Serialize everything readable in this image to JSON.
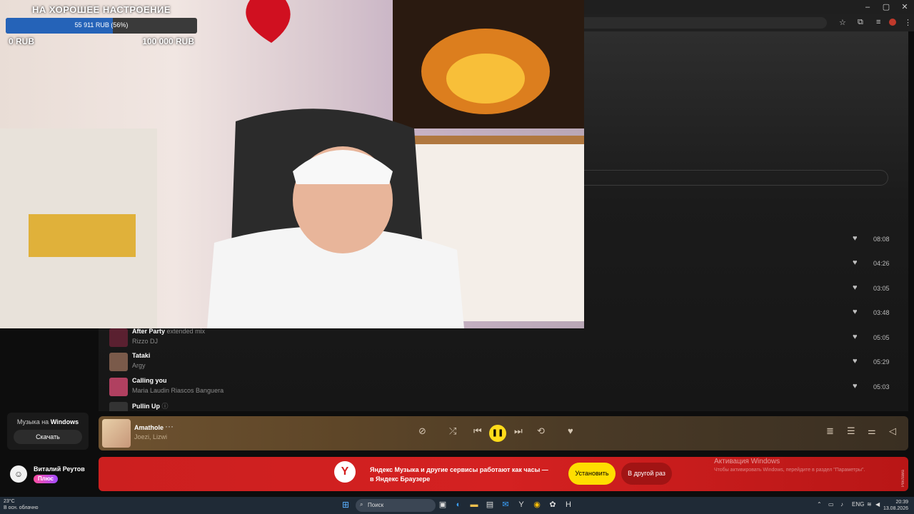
{
  "window_controls": [
    "–",
    "▢",
    "✕"
  ],
  "donation": {
    "title": "НА ХОРОШЕЕ НАСТРОЕНИЕ",
    "progress_text": "55 911 RUB (56%)",
    "progress_fraction": 0.56,
    "min_label": "0 RUB",
    "max_label": "100 000 RUB"
  },
  "durations": [
    "08:08",
    "04:26",
    "03:05",
    "03:48",
    "05:05",
    "05:29",
    "05:03"
  ],
  "tracks": [
    {
      "title": "After Party",
      "suffix": "extended mix",
      "artist": "Rizzo DJ",
      "cover_color": "#5a2030"
    },
    {
      "title": "Tataki",
      "suffix": "",
      "artist": "Argy",
      "cover_color": "#7a5a4a"
    },
    {
      "title": "Calling you",
      "suffix": "",
      "artist": "Maria Laudin Riascos Banguera",
      "cover_color": "#b04060"
    },
    {
      "title": "Pullin Up",
      "suffix": "ⓘ",
      "artist": "",
      "cover_color": "#333333"
    }
  ],
  "player": {
    "title": "Amathole",
    "more": "···",
    "artists": "Joezi, Lizwi",
    "play_state": "pause"
  },
  "sidebar": {
    "download_label_prefix": "Музыка на",
    "download_label_bold": "Windows",
    "download_button": "Скачать"
  },
  "user": {
    "name": "Виталий Реутов",
    "plus_badge": "Плюс"
  },
  "promo": {
    "logo": "Y",
    "text_line1": "Яндекс Музыка и другие сервисы работают как часы —",
    "text_line2": "в Яндекс Браузере",
    "install_button": "Установить",
    "later_button": "В другой раз",
    "ad_label": "Реклама"
  },
  "windows_activation": {
    "title": "Активация Windows",
    "subtitle": "Чтобы активировать Windows, перейдите в раздел \"Параметры\"."
  },
  "taskbar": {
    "weather_temp": "23°C",
    "weather_desc": "В осн. облачно",
    "search_placeholder": "Поиск",
    "language": "ENG",
    "time": "20:39",
    "date": "13.08.2026"
  },
  "colors": {
    "accent_yellow": "#ffdb1a",
    "donation_bar": "#2563b8",
    "promo_red": "#d42121"
  }
}
